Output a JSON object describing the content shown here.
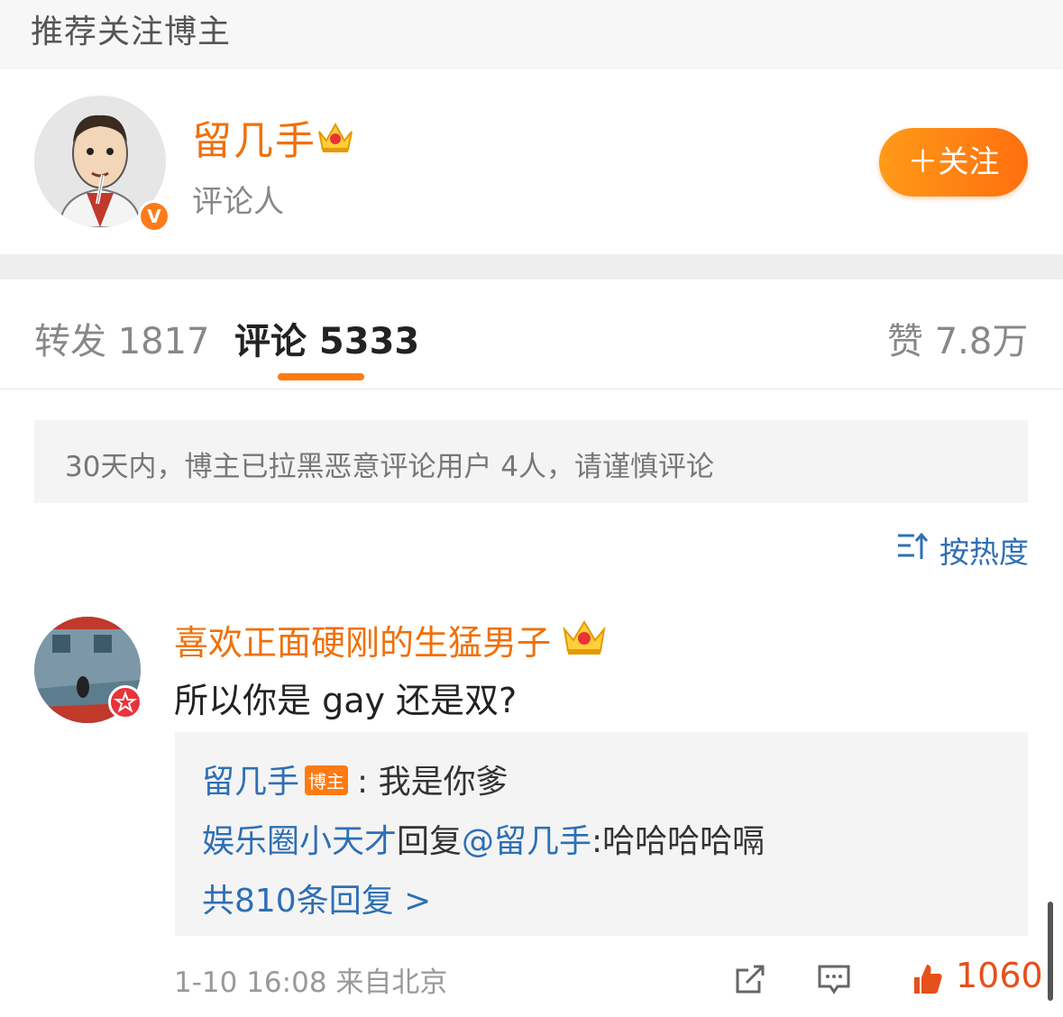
{
  "section": {
    "title": "推荐关注博主"
  },
  "blogger": {
    "name": "留几手",
    "role": "评论人",
    "verified_badge": "V",
    "follow_label": "＋关注",
    "icons": {
      "crown": "crown-icon",
      "verified": "verified-v-icon"
    }
  },
  "tabs": {
    "repost": "转发 1817",
    "comments": "评论 5333",
    "likes": "赞 7.8万",
    "active": "comments"
  },
  "notice": "30天内，博主已拉黑恶意评论用户 4人，请谨慎评论",
  "sort": {
    "label": "按热度",
    "icon": "sort-icon"
  },
  "comment": {
    "author": "喜欢正面硬刚的生猛男子",
    "text": "所以你是 gay 还是双?",
    "replies": [
      {
        "author": "留几手",
        "tag": "博主",
        "sep": ": ",
        "text": "我是你爹"
      },
      {
        "author": "娱乐圈小天才",
        "middle": "回复",
        "mention": "@留几手",
        "text": ":哈哈哈哈嗝"
      }
    ],
    "more_replies": "共810条回复 >",
    "time_location": "1-10 16:08  来自北京",
    "like_count": "1060"
  },
  "colors": {
    "accent_orange": "#ff7a12",
    "name_orange": "#f0700a",
    "link_blue": "#2e6fb5",
    "notice_bg": "#f4f4f4"
  }
}
